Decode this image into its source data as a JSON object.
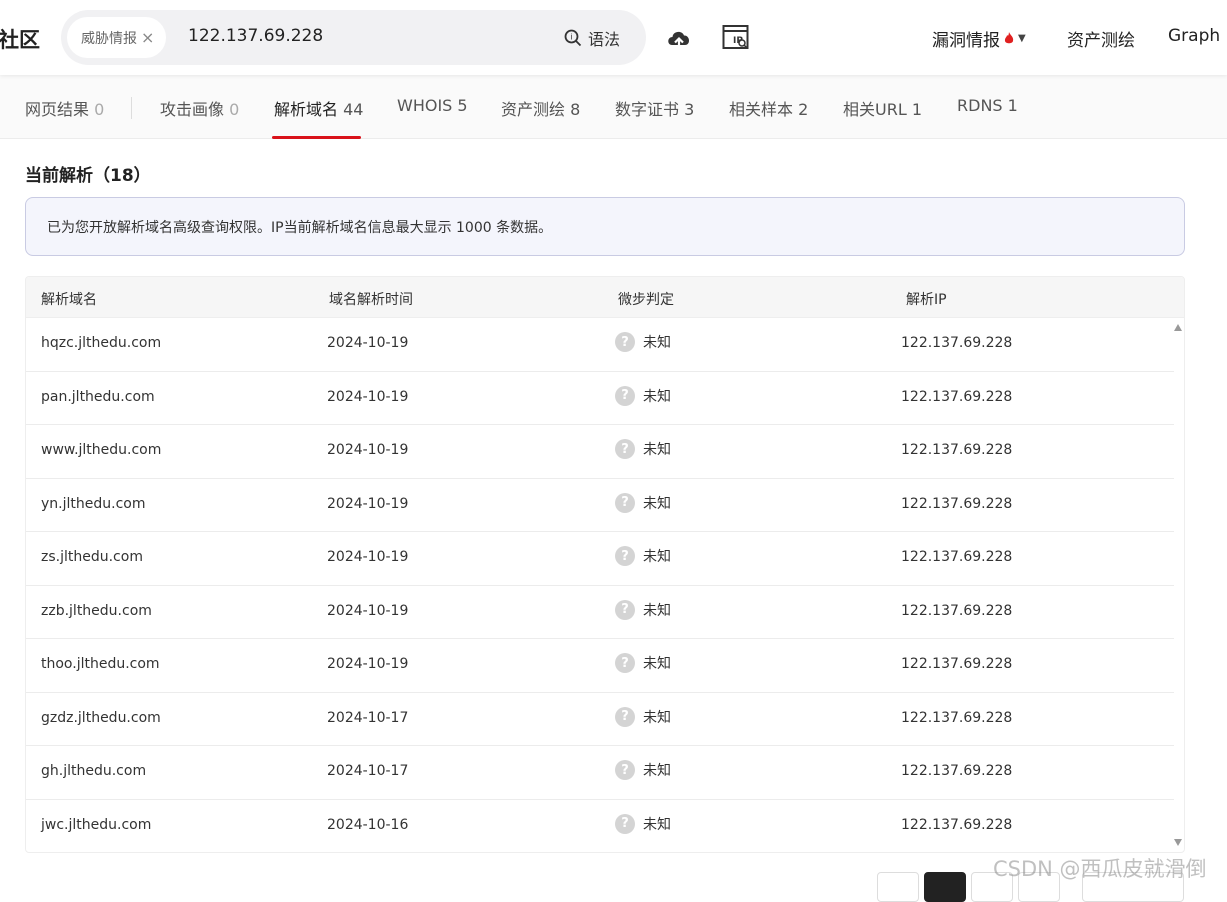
{
  "header": {
    "logo_text": "社区",
    "search_chip": "威胁情报",
    "search_value": "122.137.69.228",
    "syntax_label": "语法",
    "nav": {
      "vuln_intel": "漏洞情报",
      "asset_mapping": "资产测绘",
      "graph": "Graph"
    }
  },
  "tabs": [
    {
      "label": "网页结果",
      "count": "0"
    },
    {
      "label": "攻击画像",
      "count": "0"
    },
    {
      "label": "解析域名",
      "count": "44"
    },
    {
      "label": "WHOIS",
      "count": "5"
    },
    {
      "label": "资产测绘",
      "count": "8"
    },
    {
      "label": "数字证书",
      "count": "3"
    },
    {
      "label": "相关样本",
      "count": "2"
    },
    {
      "label": "相关URL",
      "count": "1"
    },
    {
      "label": "RDNS",
      "count": "1"
    }
  ],
  "section": {
    "title": "当前解析（18）",
    "notice": "已为您开放解析域名高级查询权限。IP当前解析域名信息最大显示 1000 条数据。"
  },
  "table": {
    "columns": [
      "解析域名",
      "域名解析时间",
      "微步判定",
      "解析IP"
    ],
    "rows": [
      {
        "domain": "hqzc.jlthedu.com",
        "time": "2024-10-19",
        "verdict": "未知",
        "ip": "122.137.69.228"
      },
      {
        "domain": "pan.jlthedu.com",
        "time": "2024-10-19",
        "verdict": "未知",
        "ip": "122.137.69.228"
      },
      {
        "domain": "www.jlthedu.com",
        "time": "2024-10-19",
        "verdict": "未知",
        "ip": "122.137.69.228"
      },
      {
        "domain": "yn.jlthedu.com",
        "time": "2024-10-19",
        "verdict": "未知",
        "ip": "122.137.69.228"
      },
      {
        "domain": "zs.jlthedu.com",
        "time": "2024-10-19",
        "verdict": "未知",
        "ip": "122.137.69.228"
      },
      {
        "domain": "zzb.jlthedu.com",
        "time": "2024-10-19",
        "verdict": "未知",
        "ip": "122.137.69.228"
      },
      {
        "domain": "thoo.jlthedu.com",
        "time": "2024-10-19",
        "verdict": "未知",
        "ip": "122.137.69.228"
      },
      {
        "domain": "gzdz.jlthedu.com",
        "time": "2024-10-17",
        "verdict": "未知",
        "ip": "122.137.69.228"
      },
      {
        "domain": "gh.jlthedu.com",
        "time": "2024-10-17",
        "verdict": "未知",
        "ip": "122.137.69.228"
      },
      {
        "domain": "jwc.jlthedu.com",
        "time": "2024-10-16",
        "verdict": "未知",
        "ip": "122.137.69.228"
      }
    ]
  },
  "watermark": "CSDN @西瓜皮就滑倒",
  "colors": {
    "accent": "#d9121a",
    "notice_bg": "#f4f5fc",
    "notice_border": "#c9cbe3"
  }
}
